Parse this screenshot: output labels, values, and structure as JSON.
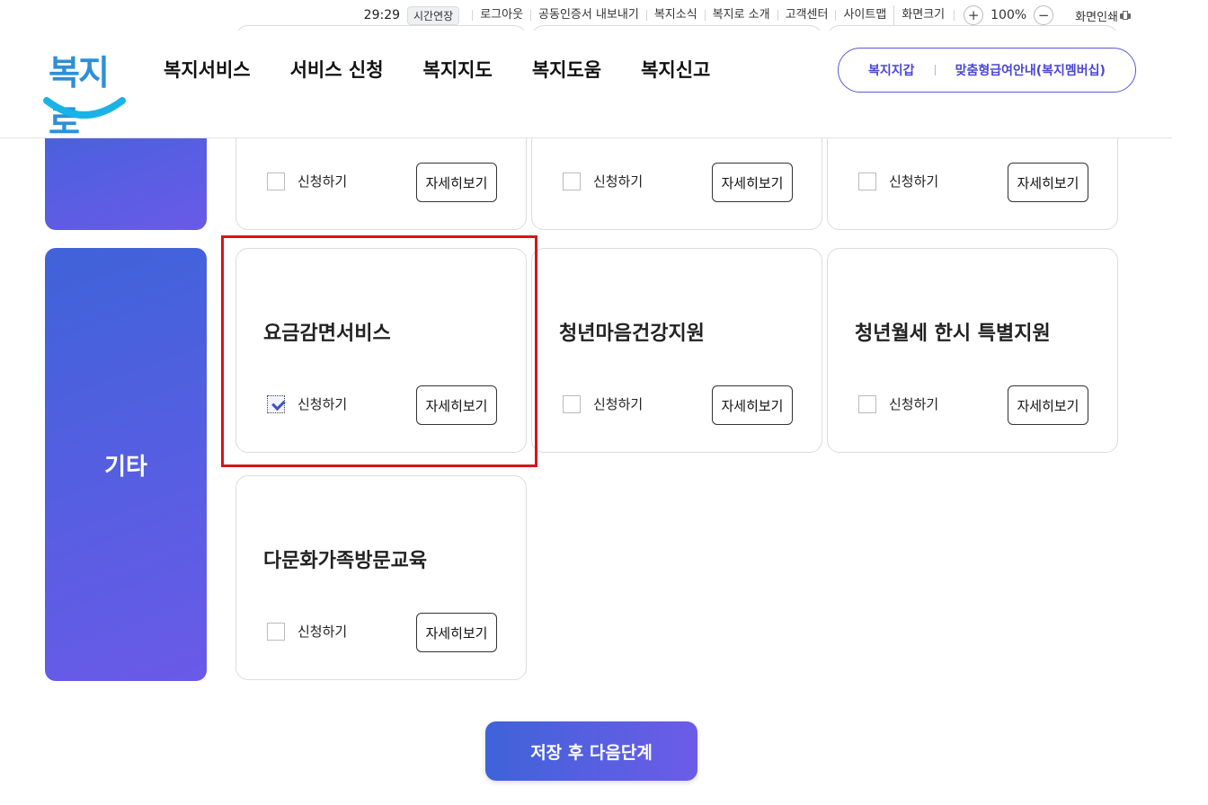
{
  "util": {
    "time": "29:29",
    "extend": "시간연장",
    "links": [
      "로그아웃",
      "공동인증서 내보내기",
      "복지소식",
      "복지로 소개",
      "고객센터",
      "사이트맵"
    ],
    "font_size_label": "화면크기",
    "zoom_in": "+",
    "zoom_value": "100%",
    "zoom_out": "−",
    "print": "화면인쇄"
  },
  "header": {
    "logo": "복지로",
    "nav": [
      "복지서비스",
      "서비스 신청",
      "복지지도",
      "복지도움",
      "복지신고"
    ],
    "top_links": [
      "복지지갑",
      "맞춤형급여안내(복지멤버십)"
    ]
  },
  "categories": [
    "기타"
  ],
  "common": {
    "apply": "신청하기",
    "detail": "자세히보기"
  },
  "cards": [
    {
      "title": "요금감면서비스",
      "checked": true
    },
    {
      "title": "청년마음건강지원",
      "checked": false
    },
    {
      "title": "청년월세 한시 특별지원",
      "checked": false
    },
    {
      "title": "다문화가족방문교육",
      "checked": false
    }
  ],
  "submit": "저장 후 다음단계"
}
